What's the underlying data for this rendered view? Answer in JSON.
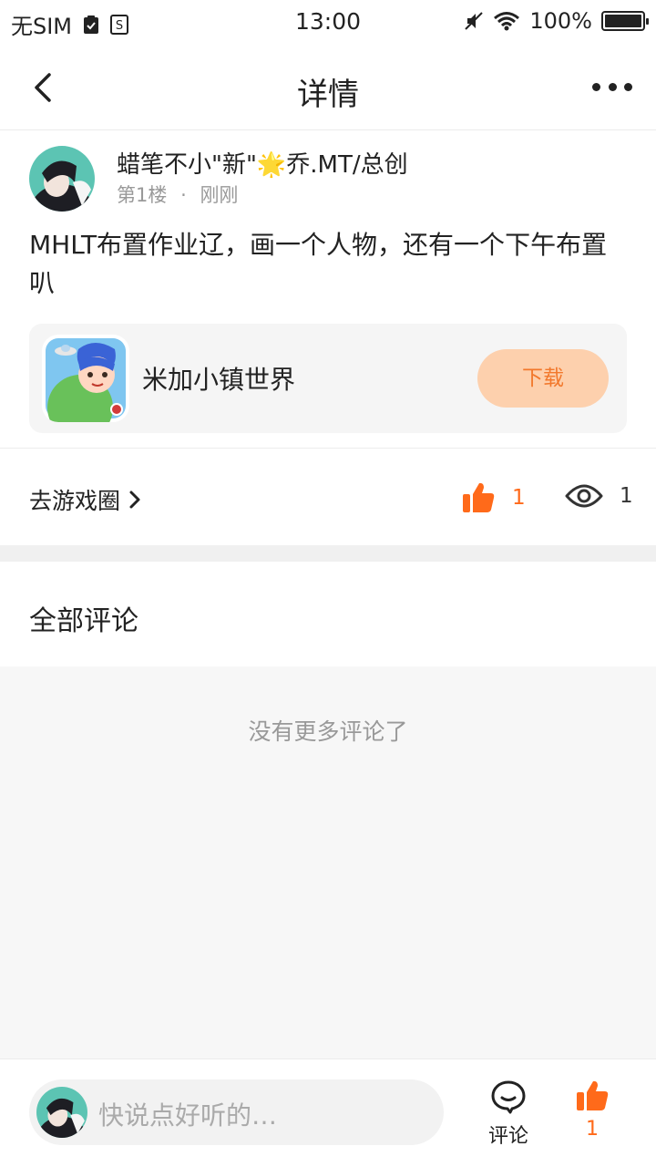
{
  "status_bar": {
    "carrier": "无SIM",
    "time": "13:00",
    "battery": "100%"
  },
  "nav": {
    "title": "详情",
    "back_icon": "chevron-left-icon",
    "more_icon": "more-dots-icon"
  },
  "post": {
    "author": "蜡笔不小\"新\"🌟乔.MT/总创",
    "floor": "第1楼",
    "separator": "·",
    "time": "刚刚",
    "content": "MHLT布置作业辽，画一个人物，还有一个下午布置叭"
  },
  "game_card": {
    "name": "米加小镇世界",
    "download_label": "下载"
  },
  "stats": {
    "goto_circle_label": "去游戏圈",
    "like_count": "1",
    "view_count": "1"
  },
  "comments": {
    "header": "全部评论",
    "empty_text": "没有更多评论了"
  },
  "bottom_bar": {
    "input_placeholder": "快说点好听的…",
    "comment_label": "评论",
    "like_count": "1"
  },
  "colors": {
    "accent": "#ff6a1a",
    "download_bg": "#fdd0ad",
    "download_text": "#f2782c"
  }
}
